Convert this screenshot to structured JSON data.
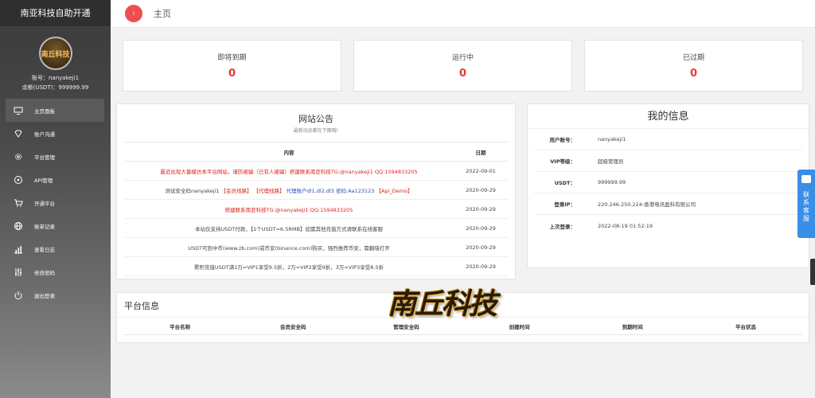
{
  "sidebar": {
    "title": "南亚科技自助开通",
    "avatar_text": "南丘科技",
    "account_line": "账号：nanyakeji1",
    "balance_line": "余额(USDT)：999999.99",
    "items": [
      {
        "label": "主页面板",
        "icon": "monitor-icon"
      },
      {
        "label": "账户沟通",
        "icon": "diamond-icon"
      },
      {
        "label": "平台管理",
        "icon": "gear-icon"
      },
      {
        "label": "API管理",
        "icon": "compass-icon"
      },
      {
        "label": "开通平台",
        "icon": "cart-icon"
      },
      {
        "label": "账单记录",
        "icon": "globe-icon"
      },
      {
        "label": "查看日志",
        "icon": "bar-chart-icon"
      },
      {
        "label": "修改密码",
        "icon": "sliders-icon"
      },
      {
        "label": "退出登录",
        "icon": "power-icon"
      }
    ]
  },
  "topbar": {
    "home_icon_text": "i",
    "home_label": "主页"
  },
  "stats": [
    {
      "label": "即将到期",
      "value": "0"
    },
    {
      "label": "运行中",
      "value": "0"
    },
    {
      "label": "已过期",
      "value": "0"
    }
  ],
  "announcement": {
    "title": "网站公告",
    "subtitle": "最新动态都在下面哦!",
    "col_content": "内容",
    "col_date": "日期",
    "rows": [
      {
        "parts": [
          {
            "t": "最近出现大量模仿本平台网站，谨防被骗（已有人被骗）搭建联系南亚科技TG:@nanyakeji1 QQ:1594833205",
            "c": "red"
          }
        ],
        "date": "2022-09-01"
      },
      {
        "parts": [
          {
            "t": "测试安全码nanyakeji1 ",
            "c": ""
          },
          {
            "t": "【会员线路】",
            "c": "red"
          },
          {
            "t": "  ",
            "c": ""
          },
          {
            "t": "【代理线路】",
            "c": "red"
          },
          {
            "t": "  代理账户dl1,dl2,dl3 密码:Aa123123  ",
            "c": "blue"
          },
          {
            "t": "【Api_Demo】",
            "c": "red"
          }
        ],
        "date": "2020-09-29"
      },
      {
        "parts": [
          {
            "t": "搭建联系南亚科技TG:@nanyakeji1 QQ:1594833205",
            "c": "red"
          }
        ],
        "date": "2020-09-29"
      },
      {
        "parts": [
          {
            "t": "本站仅支持USDT付款，【1个USDT=6.5RMB】如需其他充值方式请联系在线客服",
            "c": ""
          }
        ],
        "date": "2020-09-29"
      },
      {
        "parts": [
          {
            "t": "USDT可到中币(www.zb.com)或币安(binance.com)购买，强烈推荐币安，需翻墙打开",
            "c": ""
          }
        ],
        "date": "2020-09-29"
      },
      {
        "parts": [
          {
            "t": "累积充值USDT满1万=VIP1享受9.5折，2万=VIP2享受9折，3万=VIP3享受8.5折",
            "c": ""
          }
        ],
        "date": "2020-09-29"
      }
    ]
  },
  "my_info": {
    "title": "我的信息",
    "rows": [
      {
        "k": "用户账号：",
        "v": "nanyakeji1"
      },
      {
        "k": "VIP等级：",
        "v": "超级管理员"
      },
      {
        "k": "USDT：",
        "v": "999999.99"
      },
      {
        "k": "登录IP：",
        "v": "220.246.250.224-香港电讯盈科有限公司"
      },
      {
        "k": "上次登录：",
        "v": "2022-08-19 01:52:19"
      }
    ]
  },
  "platform": {
    "title": "平台信息",
    "columns": [
      "平台名称",
      "会员安全码",
      "管理安全码",
      "创建时间",
      "到期时间",
      "平台状态"
    ]
  },
  "logo_text": "南丘科技",
  "contact": {
    "label": "联系客服"
  },
  "colors": {
    "accent_red": "#e8392e",
    "home_badge": "#f04e4e",
    "contact_blue": "#3a8ee6"
  }
}
